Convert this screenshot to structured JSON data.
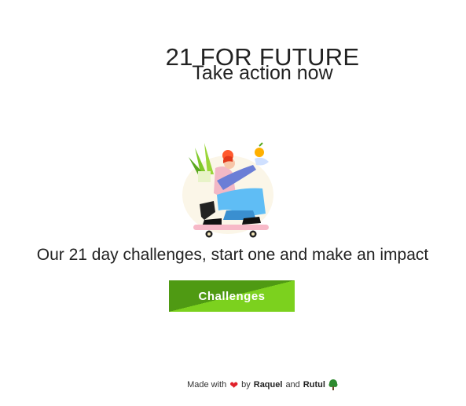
{
  "header": {
    "title": "21 FOR FUTURE",
    "subtitle": "Take action now"
  },
  "hero": {
    "illustration_icon": "skateboarder-with-vegetables-illustration"
  },
  "main": {
    "tagline": "Our 21 day challenges, start one and make an impact",
    "cta_label": "Challenges",
    "cta_colors": {
      "dark": "#4f9a13",
      "light": "#7cd11e"
    }
  },
  "footer": {
    "made_with": "Made with",
    "heart_icon": "heart-icon",
    "by": "by",
    "author_1": "Raquel",
    "and": "and",
    "author_2": "Rutul",
    "tree_icon": "tree-icon"
  }
}
